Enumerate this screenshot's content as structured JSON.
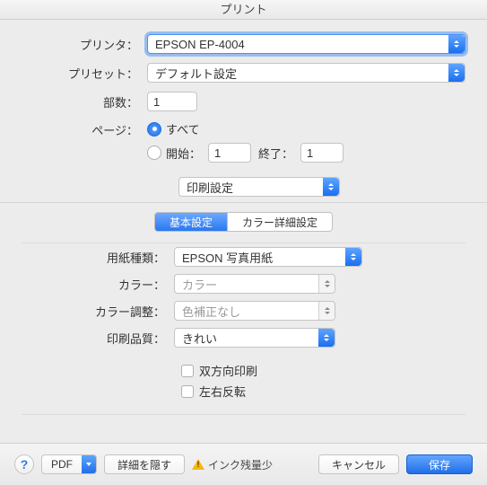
{
  "title": "プリント",
  "labels": {
    "printer": "プリンタ：",
    "preset": "プリセット：",
    "copies": "部数：",
    "pages": "ページ：",
    "all": "すべて",
    "from": "開始：",
    "to": "終了：",
    "paperType": "用紙種類：",
    "color": "カラー：",
    "colorAdjust": "カラー調整：",
    "quality": "印刷品質：",
    "bidirectional": "双方向印刷",
    "mirror": "左右反転"
  },
  "values": {
    "printer": "EPSON EP-4004",
    "preset": "デフォルト設定",
    "copies": "1",
    "from": "1",
    "to": "1",
    "section": "印刷設定",
    "paperType": "EPSON 写真用紙",
    "color": "カラー",
    "colorAdjust": "色補正なし",
    "quality": "きれい"
  },
  "tabs": {
    "basic": "基本設定",
    "advanced": "カラー詳細設定"
  },
  "footer": {
    "help": "?",
    "pdf": "PDF",
    "hideDetails": "詳細を隠す",
    "inkLow": "インク残量少",
    "cancel": "キャンセル",
    "save": "保存"
  }
}
